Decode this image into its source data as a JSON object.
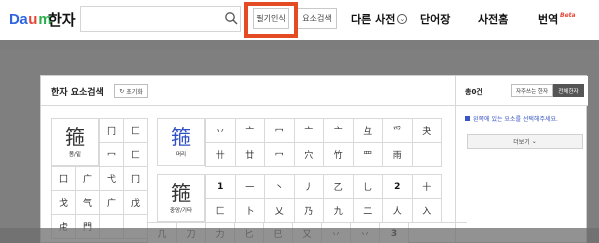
{
  "header": {
    "logo": {
      "part1": "Da",
      "part2": "u",
      "part3": "m"
    },
    "title": "한자",
    "search": {
      "value": "",
      "placeholder": ""
    },
    "handwriting_label": "필기인식",
    "component_search_label": "요소검색",
    "nav": {
      "dict": "다른 사전",
      "words": "단어장",
      "dicthome": "사전홈",
      "translate": "번역",
      "beta": "Beta"
    }
  },
  "panel": {
    "title": "한자 요소검색",
    "reset_label": "초기화",
    "result_count": "총0건",
    "toggle_frequent": "자주쓰는 한자",
    "toggle_all": "전체한자",
    "notice": "왼쪽에 있는 요소를 선택해주세요.",
    "more_label": "더보기"
  },
  "left_grid": {
    "big": {
      "glyph": "箍",
      "label": "몸/밑"
    },
    "top_cells": [
      "冂",
      "匚",
      "冖",
      "匚"
    ],
    "rows": [
      [
        "囗",
        "广",
        "弋",
        "冂"
      ],
      [
        "戈",
        "气",
        "广",
        "戊"
      ],
      [
        "虍",
        "門",
        "",
        ""
      ]
    ]
  },
  "mid_grid_top": {
    "big": {
      "glyph": "箍",
      "label": "머리"
    },
    "rows": [
      [
        "丷",
        "亠",
        "冖",
        "亠",
        "亠",
        "彑",
        "爫",
        "夬"
      ],
      [
        "卄",
        "廿",
        "冖",
        "穴",
        "竹",
        "罒",
        "雨",
        ""
      ]
    ]
  },
  "mid_grid_bottom": {
    "big": {
      "glyph": "箍",
      "label": "중앙/기타"
    },
    "rows": [
      [
        "1",
        "一",
        "丶",
        "丿",
        "乙",
        "乚",
        "2",
        "十",
        "乂"
      ],
      [
        "ㄏ",
        "匚",
        "卜",
        "乂",
        "乃",
        "九",
        "二",
        "人",
        "入",
        "八"
      ],
      [
        "几",
        "刀",
        "力",
        "匕",
        "巳",
        "又",
        "丷",
        "丷",
        "3"
      ]
    ]
  }
}
